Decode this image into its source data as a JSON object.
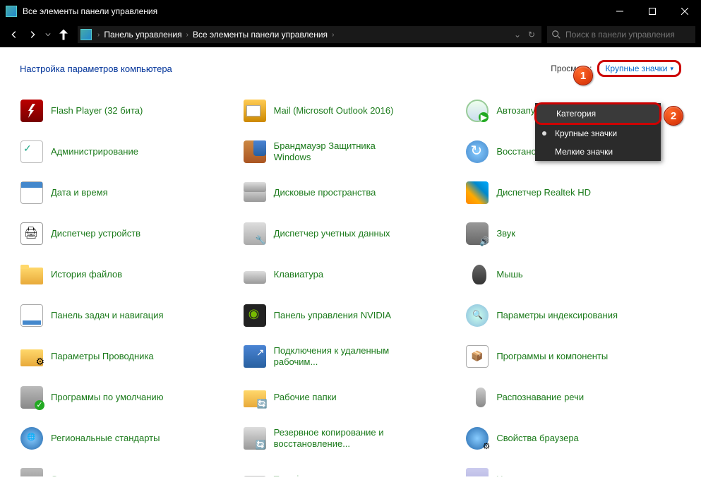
{
  "titlebar": {
    "text": "Все элементы панели управления"
  },
  "breadcrumb": {
    "root": "Панель управления",
    "current": "Все элементы панели управления"
  },
  "search": {
    "placeholder": "Поиск в панели управления"
  },
  "header": {
    "title": "Настройка параметров компьютера",
    "viewby_label": "Просмотр:",
    "viewby_value": "Крупные значки"
  },
  "dropdown": {
    "items": [
      {
        "label": "Категория"
      },
      {
        "label": "Крупные значки"
      },
      {
        "label": "Мелкие значки"
      }
    ]
  },
  "markers": {
    "m1": "1",
    "m2": "2"
  },
  "items": [
    {
      "label": "Flash Player (32 бита)",
      "icon": "ic-flash"
    },
    {
      "label": "Mail (Microsoft Outlook 2016)",
      "icon": "ic-mail"
    },
    {
      "label": "Автозапуск",
      "icon": "ic-auto"
    },
    {
      "label": "Администрирование",
      "icon": "ic-admin"
    },
    {
      "label": "Брандмауэр Защитника Windows",
      "icon": "ic-firewall"
    },
    {
      "label": "Восстановление",
      "icon": "ic-restore"
    },
    {
      "label": "Дата и время",
      "icon": "ic-date"
    },
    {
      "label": "Дисковые пространства",
      "icon": "ic-disk"
    },
    {
      "label": "Диспетчер Realtek HD",
      "icon": "ic-realtek"
    },
    {
      "label": "Диспетчер устройств",
      "icon": "ic-device"
    },
    {
      "label": "Диспетчер учетных данных",
      "icon": "ic-devmgr"
    },
    {
      "label": "Звук",
      "icon": "ic-sound"
    },
    {
      "label": "История файлов",
      "icon": "ic-folder"
    },
    {
      "label": "Клавиатура",
      "icon": "ic-keyboard"
    },
    {
      "label": "Мышь",
      "icon": "ic-mouse"
    },
    {
      "label": "Панель задач и навигация",
      "icon": "ic-taskbar"
    },
    {
      "label": "Панель управления NVIDIA",
      "icon": "ic-nvidia"
    },
    {
      "label": "Параметры индексирования",
      "icon": "ic-indexing"
    },
    {
      "label": "Параметры Проводника",
      "icon": "ic-explorer"
    },
    {
      "label": "Подключения к удаленным рабочим...",
      "icon": "ic-remote"
    },
    {
      "label": "Программы и компоненты",
      "icon": "ic-programs"
    },
    {
      "label": "Программы по умолчанию",
      "icon": "ic-default"
    },
    {
      "label": "Рабочие папки",
      "icon": "ic-workfolders"
    },
    {
      "label": "Распознавание речи",
      "icon": "ic-speech"
    },
    {
      "label": "Региональные стандарты",
      "icon": "ic-region"
    },
    {
      "label": "Резервное копирование и восстановление...",
      "icon": "ic-backup"
    },
    {
      "label": "Свойства браузера",
      "icon": "ic-browser"
    }
  ],
  "truncated_row": [
    {
      "label": "Система",
      "icon": "ic-system"
    },
    {
      "label": "Телефон и модем",
      "icon": "ic-phone"
    },
    {
      "label": "Управление цветом",
      "icon": "ic-color"
    }
  ]
}
